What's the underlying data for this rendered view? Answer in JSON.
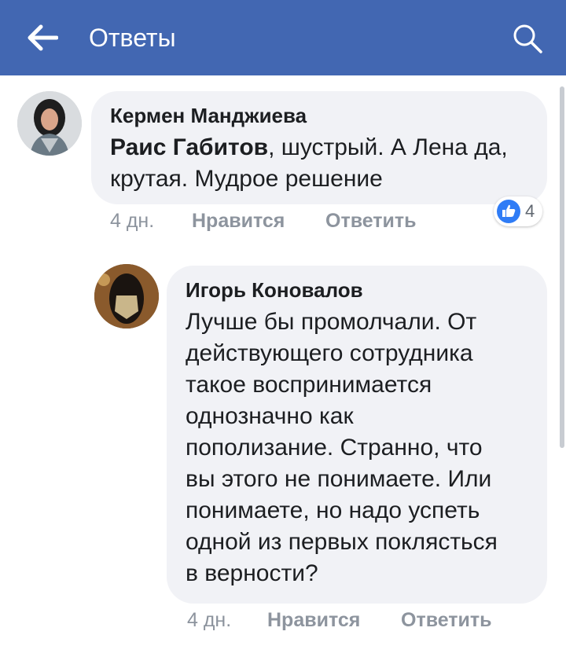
{
  "header": {
    "title": "Ответы",
    "back_icon": "arrow-left-icon",
    "search_icon": "search-icon",
    "background": "#4267b2"
  },
  "comments": [
    {
      "author": "Кермен Манджиева",
      "mention": "Раис Габитов",
      "line1_rest": ", шустрый. А Лена да,",
      "line2": "крутая. Мудрое решение",
      "time": "4 дн.",
      "like_label": "Нравится",
      "reply_label": "Ответить",
      "reaction_count": "4",
      "reaction_icon": "thumbs-up-icon"
    },
    {
      "author": "Игорь Коновалов",
      "lines": [
        "Лучше бы промолчали. От",
        "действующего сотрудника",
        "такое воспринимается",
        "однозначно как",
        "пополизание. Странно, что",
        "вы этого не понимаете. Или",
        "понимаете, но надо успеть",
        "одной из первых поклясться",
        "в верности?"
      ],
      "time": "4 дн.",
      "like_label": "Нравится",
      "reply_label": "Ответить"
    }
  ],
  "colors": {
    "bubble": "#f1f2f6",
    "meta_text": "#8d949e",
    "like_blue": "#2f7cf6"
  }
}
